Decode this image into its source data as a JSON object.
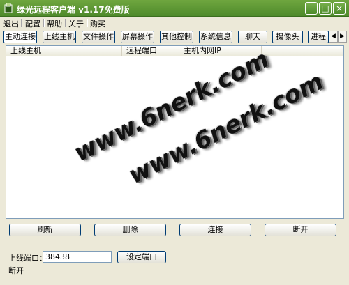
{
  "window": {
    "title": "绿光远程客户端 v1.17免费版",
    "minimize_glyph": "_",
    "maximize_glyph": "□",
    "close_glyph": "×"
  },
  "menu": [
    "退出",
    "配置",
    "帮助",
    "关于",
    "购买"
  ],
  "tabs": [
    "主动连接",
    "上线主机",
    "文件操作",
    "屏幕操作",
    "其他控制",
    "系统信息",
    "聊天",
    "摄像头",
    "进程"
  ],
  "tab_scroll": {
    "left": "◀",
    "right": "▶"
  },
  "list": {
    "columns": [
      "上线主机",
      "远程端口",
      "主机内网IP"
    ],
    "rows": []
  },
  "watermark": [
    "www.6nerk.com",
    "www.6nerk.com"
  ],
  "actions": [
    "刷新",
    "删除",
    "连接",
    "断开"
  ],
  "port": {
    "label": "上线端口：",
    "value": "38438",
    "set_button": "设定端口"
  },
  "status": "断开"
}
